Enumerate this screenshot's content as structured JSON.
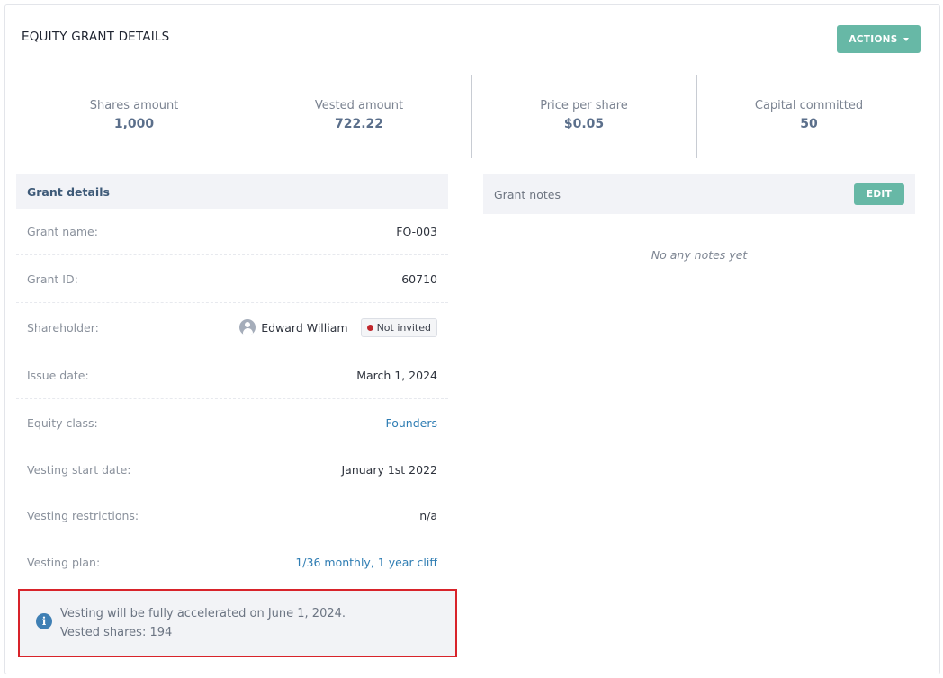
{
  "card": {
    "title": "EQUITY GRANT DETAILS",
    "actions_label": "ACTIONS"
  },
  "stats": [
    {
      "label": "Shares amount",
      "value": "1,000"
    },
    {
      "label": "Vested amount",
      "value": "722.22"
    },
    {
      "label": "Price per share",
      "value": "$0.05"
    },
    {
      "label": "Capital committed",
      "value": "50"
    }
  ],
  "details": {
    "header": "Grant details",
    "rows": [
      {
        "label": "Grant name:",
        "value": "FO-003"
      },
      {
        "label": "Grant ID:",
        "value": "60710"
      },
      {
        "label": "Shareholder:",
        "value": "Edward William",
        "badge": "Not invited"
      },
      {
        "label": "Issue date:",
        "value": "March 1, 2024"
      },
      {
        "label": "Equity class:",
        "value": "Founders"
      },
      {
        "label": "Vesting start date:",
        "value": "January 1st 2022"
      },
      {
        "label": "Vesting restrictions:",
        "value": "n/a"
      },
      {
        "label": "Vesting plan:",
        "value": "1/36 monthly, 1 year cliff"
      }
    ]
  },
  "notice": {
    "line1": "Vesting will be fully accelerated on June 1, 2024.",
    "line2": "Vested shares: 194"
  },
  "notes": {
    "header": "Grant notes",
    "edit_label": "EDIT",
    "empty_text": "No any notes yet"
  },
  "colors": {
    "accent": "#67b8a6",
    "link": "#2f7db3",
    "highlight_border": "#d8232a",
    "status_dot": "#c0262c"
  },
  "icons": {
    "actions": "caret-down-icon",
    "shareholder": "user-avatar-icon",
    "notice": "info-icon"
  }
}
